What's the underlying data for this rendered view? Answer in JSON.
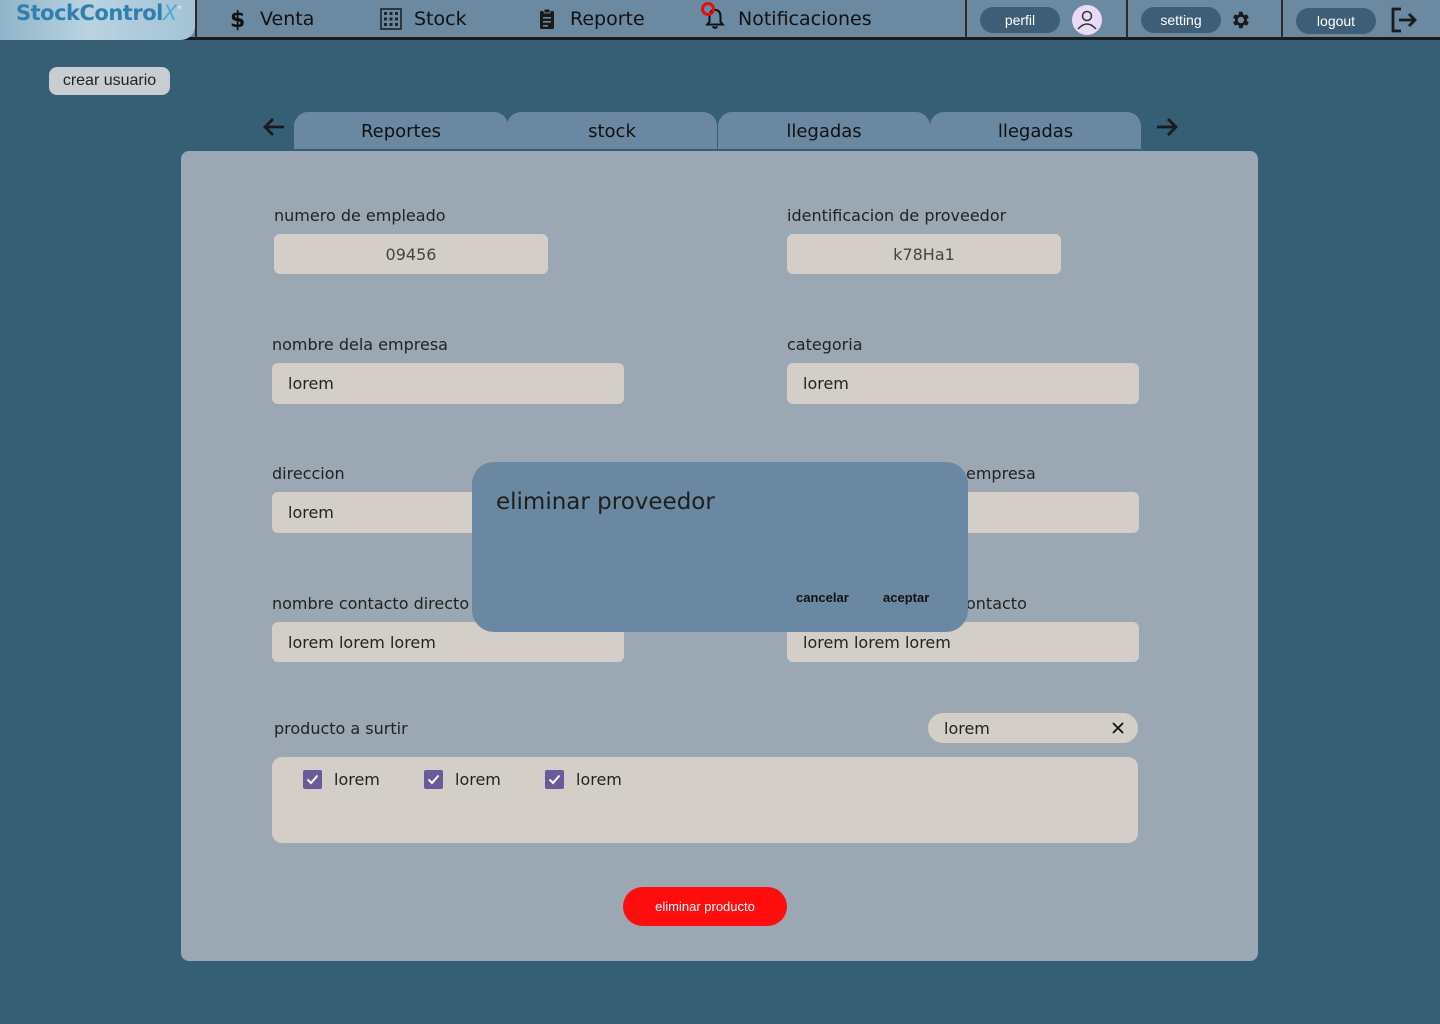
{
  "app": {
    "logo_main": "StockControl",
    "logo_accent": "X",
    "logo_mark": "*"
  },
  "nav": {
    "venta": "Venta",
    "stock": "Stock",
    "reporte": "Reporte",
    "notificaciones": "Notificaciones",
    "perfil": "perfil",
    "setting": "setting",
    "logout": "logout"
  },
  "crear_usuario": "crear usuario",
  "tabs": [
    "Reportes",
    "stock",
    "llegadas",
    "llegadas"
  ],
  "form": {
    "numero_empleado": {
      "label": "numero de empleado",
      "value": "09456"
    },
    "id_proveedor": {
      "label": "identificacion de proveedor",
      "value": "k78Ha1"
    },
    "nombre_empresa": {
      "label": "nombre dela empresa",
      "value": "lorem"
    },
    "categoria": {
      "label": "categoria",
      "value": "lorem"
    },
    "direccion": {
      "label": "direccion",
      "value": "lorem"
    },
    "telefono_empresa": {
      "label_visible": "empresa",
      "value": ""
    },
    "nombre_contacto": {
      "label": "nombre contacto directo",
      "value": "lorem lorem lorem"
    },
    "telefono_contacto": {
      "label_visible": "ontacto",
      "value": "lorem lorem lorem"
    },
    "producto": {
      "label": "producto a surtir",
      "search_value": "lorem",
      "items": [
        "lorem",
        "lorem",
        "lorem"
      ]
    }
  },
  "eliminar_producto": "eliminar producto",
  "modal": {
    "title": "eliminar proveedor",
    "cancel": "cancelar",
    "accept": "aceptar"
  },
  "colors": {
    "background": "#365e75",
    "topbar": "#6b8aa2",
    "panel": "#9ba7b2",
    "field": "#d3cfc8",
    "danger": "#ff0d0d",
    "checkbox": "#6a5a9a",
    "notification_dot": "#e01010"
  }
}
